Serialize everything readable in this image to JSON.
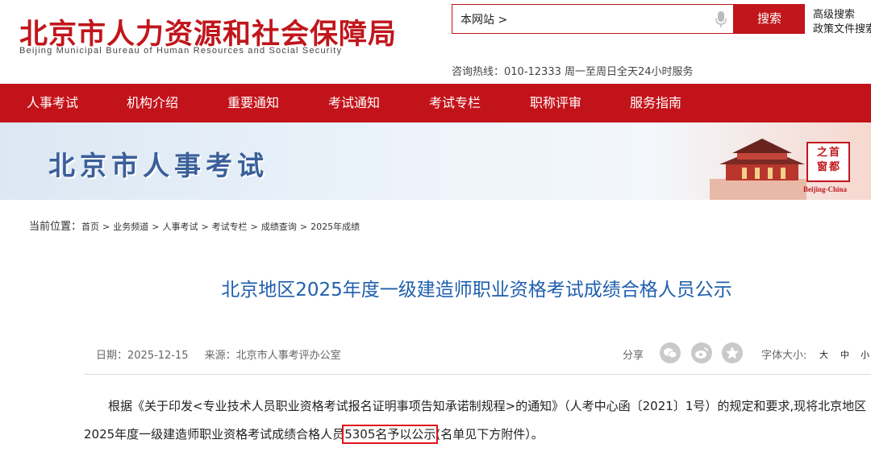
{
  "header": {
    "logo_cn": "北京市人力资源和社会保障局",
    "logo_en": "Beijing Municipal Bureau of Human Resources and Social Security",
    "search_scope": "本网站 >",
    "search_button": "搜索",
    "advanced_search": "高级搜索",
    "policy_search": "政策文件搜索",
    "hotline": "咨询热线：010-12333 周一至周日全天24小时服务"
  },
  "nav": {
    "items": [
      {
        "label": "人事考试"
      },
      {
        "label": "机构介绍"
      },
      {
        "label": "重要通知"
      },
      {
        "label": "考试通知"
      },
      {
        "label": "考试专栏"
      },
      {
        "label": "职称评审"
      },
      {
        "label": "服务指南"
      }
    ]
  },
  "banner": {
    "title": "北京市人事考试",
    "seal_text": "之首 窗都",
    "seal_caption": "Beijing-China"
  },
  "breadcrumb": {
    "label": "当前位置：",
    "items": [
      "首页",
      "业务频道",
      "人事考试",
      "考试专栏",
      "成绩查询",
      "2025年成绩"
    ],
    "separator": ">"
  },
  "article": {
    "title": "北京地区2025年度一级建造师职业资格考试成绩合格人员公示",
    "date": "日期：2025-12-15",
    "source": "来源：北京市人事考评办公室",
    "share_label": "分享",
    "font_size_label": "字体大小:",
    "font_sizes": [
      "大",
      "中",
      "小"
    ],
    "body_part1": "根据《关于印发<专业技术人员职业资格考试报名证明事项告知承诺制规程>的通知》（人考中心函〔2021〕1号）的规定和要求,现将北京地区2025年度一级建造师职业资格考试成绩合格人员",
    "body_highlight": "5305名予以公示",
    "body_part2": "(名单见下方附件）。"
  },
  "colors": {
    "brand_red": "#c3131a",
    "title_blue": "#1f5fae",
    "banner_blue": "#3a5f9a"
  },
  "icons": [
    "microphone-icon",
    "wechat-icon",
    "weibo-icon",
    "star-icon"
  ]
}
